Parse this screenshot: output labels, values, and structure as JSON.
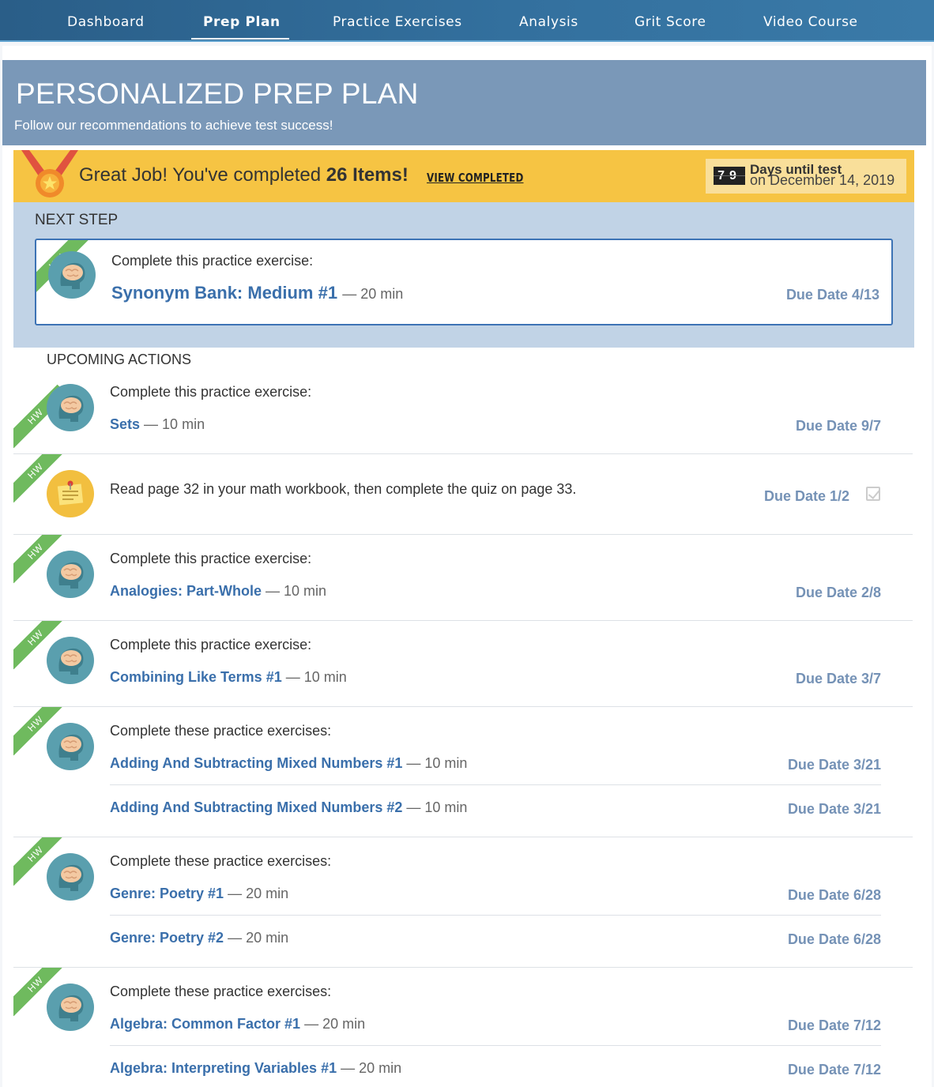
{
  "nav": {
    "items": [
      "Dashboard",
      "Prep Plan",
      "Practice Exercises",
      "Analysis",
      "Grit Score",
      "Video Course"
    ],
    "active": "Prep Plan"
  },
  "header": {
    "title": "PERSONALIZED PREP PLAN",
    "subtitle": "Follow our recommendations to achieve test success!"
  },
  "banner": {
    "text_pre": "Great Job! You've completed ",
    "count_text": "26 Items!",
    "view_completed": "VIEW COMPLETED",
    "days_digits": "79",
    "days_label": "Days until test",
    "days_date": "on December 14, 2019"
  },
  "next_step": {
    "section_label": "NEXT STEP",
    "ribbon": "HW",
    "instruction": "Complete this practice exercise:",
    "title": "Synonym Bank: Medium #1",
    "duration": "— 20 min",
    "due": "Due Date 4/13"
  },
  "upcoming": {
    "section_label": "UPCOMING ACTIONS",
    "items": [
      {
        "ribbon": "HW",
        "instruction": "Complete this practice exercise:",
        "exercises": [
          {
            "title": "Sets",
            "duration": "— 10 min",
            "due": "Due Date 9/7"
          }
        ]
      },
      {
        "ribbon": "HW",
        "instruction": "Read page 32 in your math workbook, then complete the quiz on page 33.",
        "due": "Due Date 1/2"
      },
      {
        "ribbon": "HW",
        "instruction": "Complete this practice exercise:",
        "exercises": [
          {
            "title": "Analogies: Part-Whole",
            "duration": "— 10 min",
            "due": "Due Date 2/8"
          }
        ]
      },
      {
        "ribbon": "HW",
        "instruction": "Complete this practice exercise:",
        "exercises": [
          {
            "title": "Combining Like Terms #1",
            "duration": "— 10 min",
            "due": "Due Date 3/7"
          }
        ]
      },
      {
        "ribbon": "HW",
        "instruction": "Complete these practice exercises:",
        "exercises": [
          {
            "title": "Adding And Subtracting Mixed Numbers #1",
            "duration": "— 10 min",
            "due": "Due Date 3/21"
          },
          {
            "title": "Adding And Subtracting Mixed Numbers #2",
            "duration": "— 10 min",
            "due": "Due Date 3/21"
          }
        ]
      },
      {
        "ribbon": "HW",
        "instruction": "Complete these practice exercises:",
        "exercises": [
          {
            "title": "Genre: Poetry #1",
            "duration": "— 20 min",
            "due": "Due Date 6/28"
          },
          {
            "title": "Genre: Poetry #2",
            "duration": "— 20 min",
            "due": "Due Date 6/28"
          }
        ]
      },
      {
        "ribbon": "HW",
        "instruction": "Complete these practice exercises:",
        "exercises": [
          {
            "title": "Algebra: Common Factor #1",
            "duration": "— 20 min",
            "due": "Due Date 7/12"
          },
          {
            "title": "Algebra: Interpreting Variables #1",
            "duration": "— 20 min",
            "due": "Due Date 7/12"
          }
        ]
      }
    ]
  },
  "icons": {
    "exercise": "brain-icon",
    "reading": "sticky-note-icon",
    "medal": "medal-icon",
    "done": "checkbox-icon"
  },
  "colors": {
    "nav_bg": "#2f6994",
    "header_bg": "#7a98b8",
    "banner_bg": "#f6c443",
    "next_bg": "#c1d3e6",
    "link": "#3a6fab",
    "due": "#7592b6",
    "ribbon": "#6fba5e",
    "icon_teal": "#5a9fae"
  }
}
